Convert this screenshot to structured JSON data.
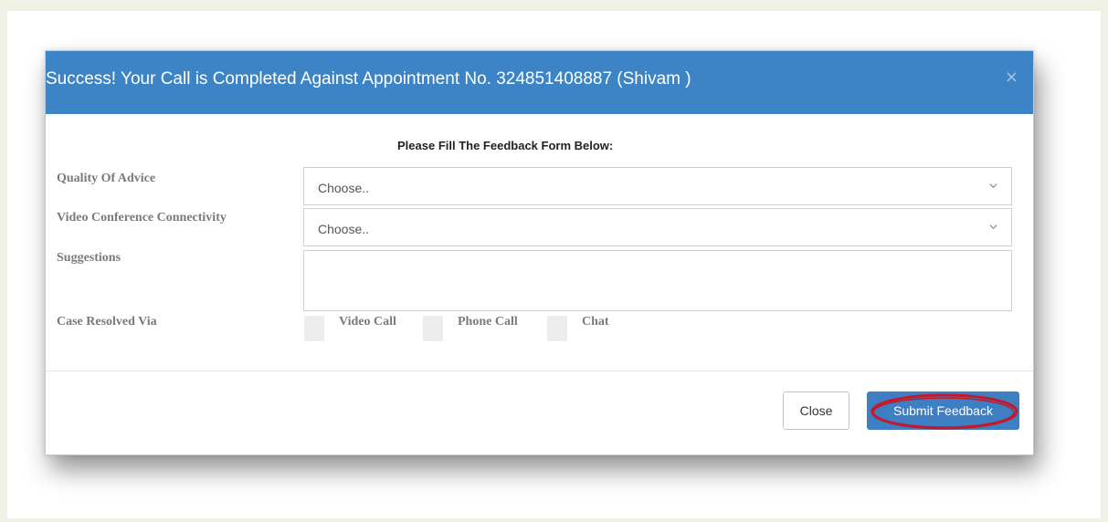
{
  "dialog": {
    "title": "Success! Your Call is Completed Against Appointment No. 324851408887 (Shivam )",
    "close_icon": "×"
  },
  "form": {
    "heading": "Please Fill The Feedback Form Below:",
    "quality_label": "Quality Of Advice",
    "quality_value": "Choose..",
    "connectivity_label": "Video Conference Connectivity",
    "connectivity_value": "Choose..",
    "suggestions_label": "Suggestions",
    "suggestions_value": "",
    "resolved_label": "Case Resolved Via",
    "resolved_options": [
      "Video Call",
      "Phone Call",
      "Chat"
    ]
  },
  "footer": {
    "close_label": "Close",
    "submit_label": "Submit Feedback"
  },
  "colors": {
    "header_bg": "#3c84c6",
    "submit_bg": "#3d7fc2",
    "highlight": "#c4182b"
  },
  "icons": {
    "dialog_close": "close-icon",
    "select_arrow": "chevron-down-icon",
    "annotation": "highlight-circle"
  }
}
